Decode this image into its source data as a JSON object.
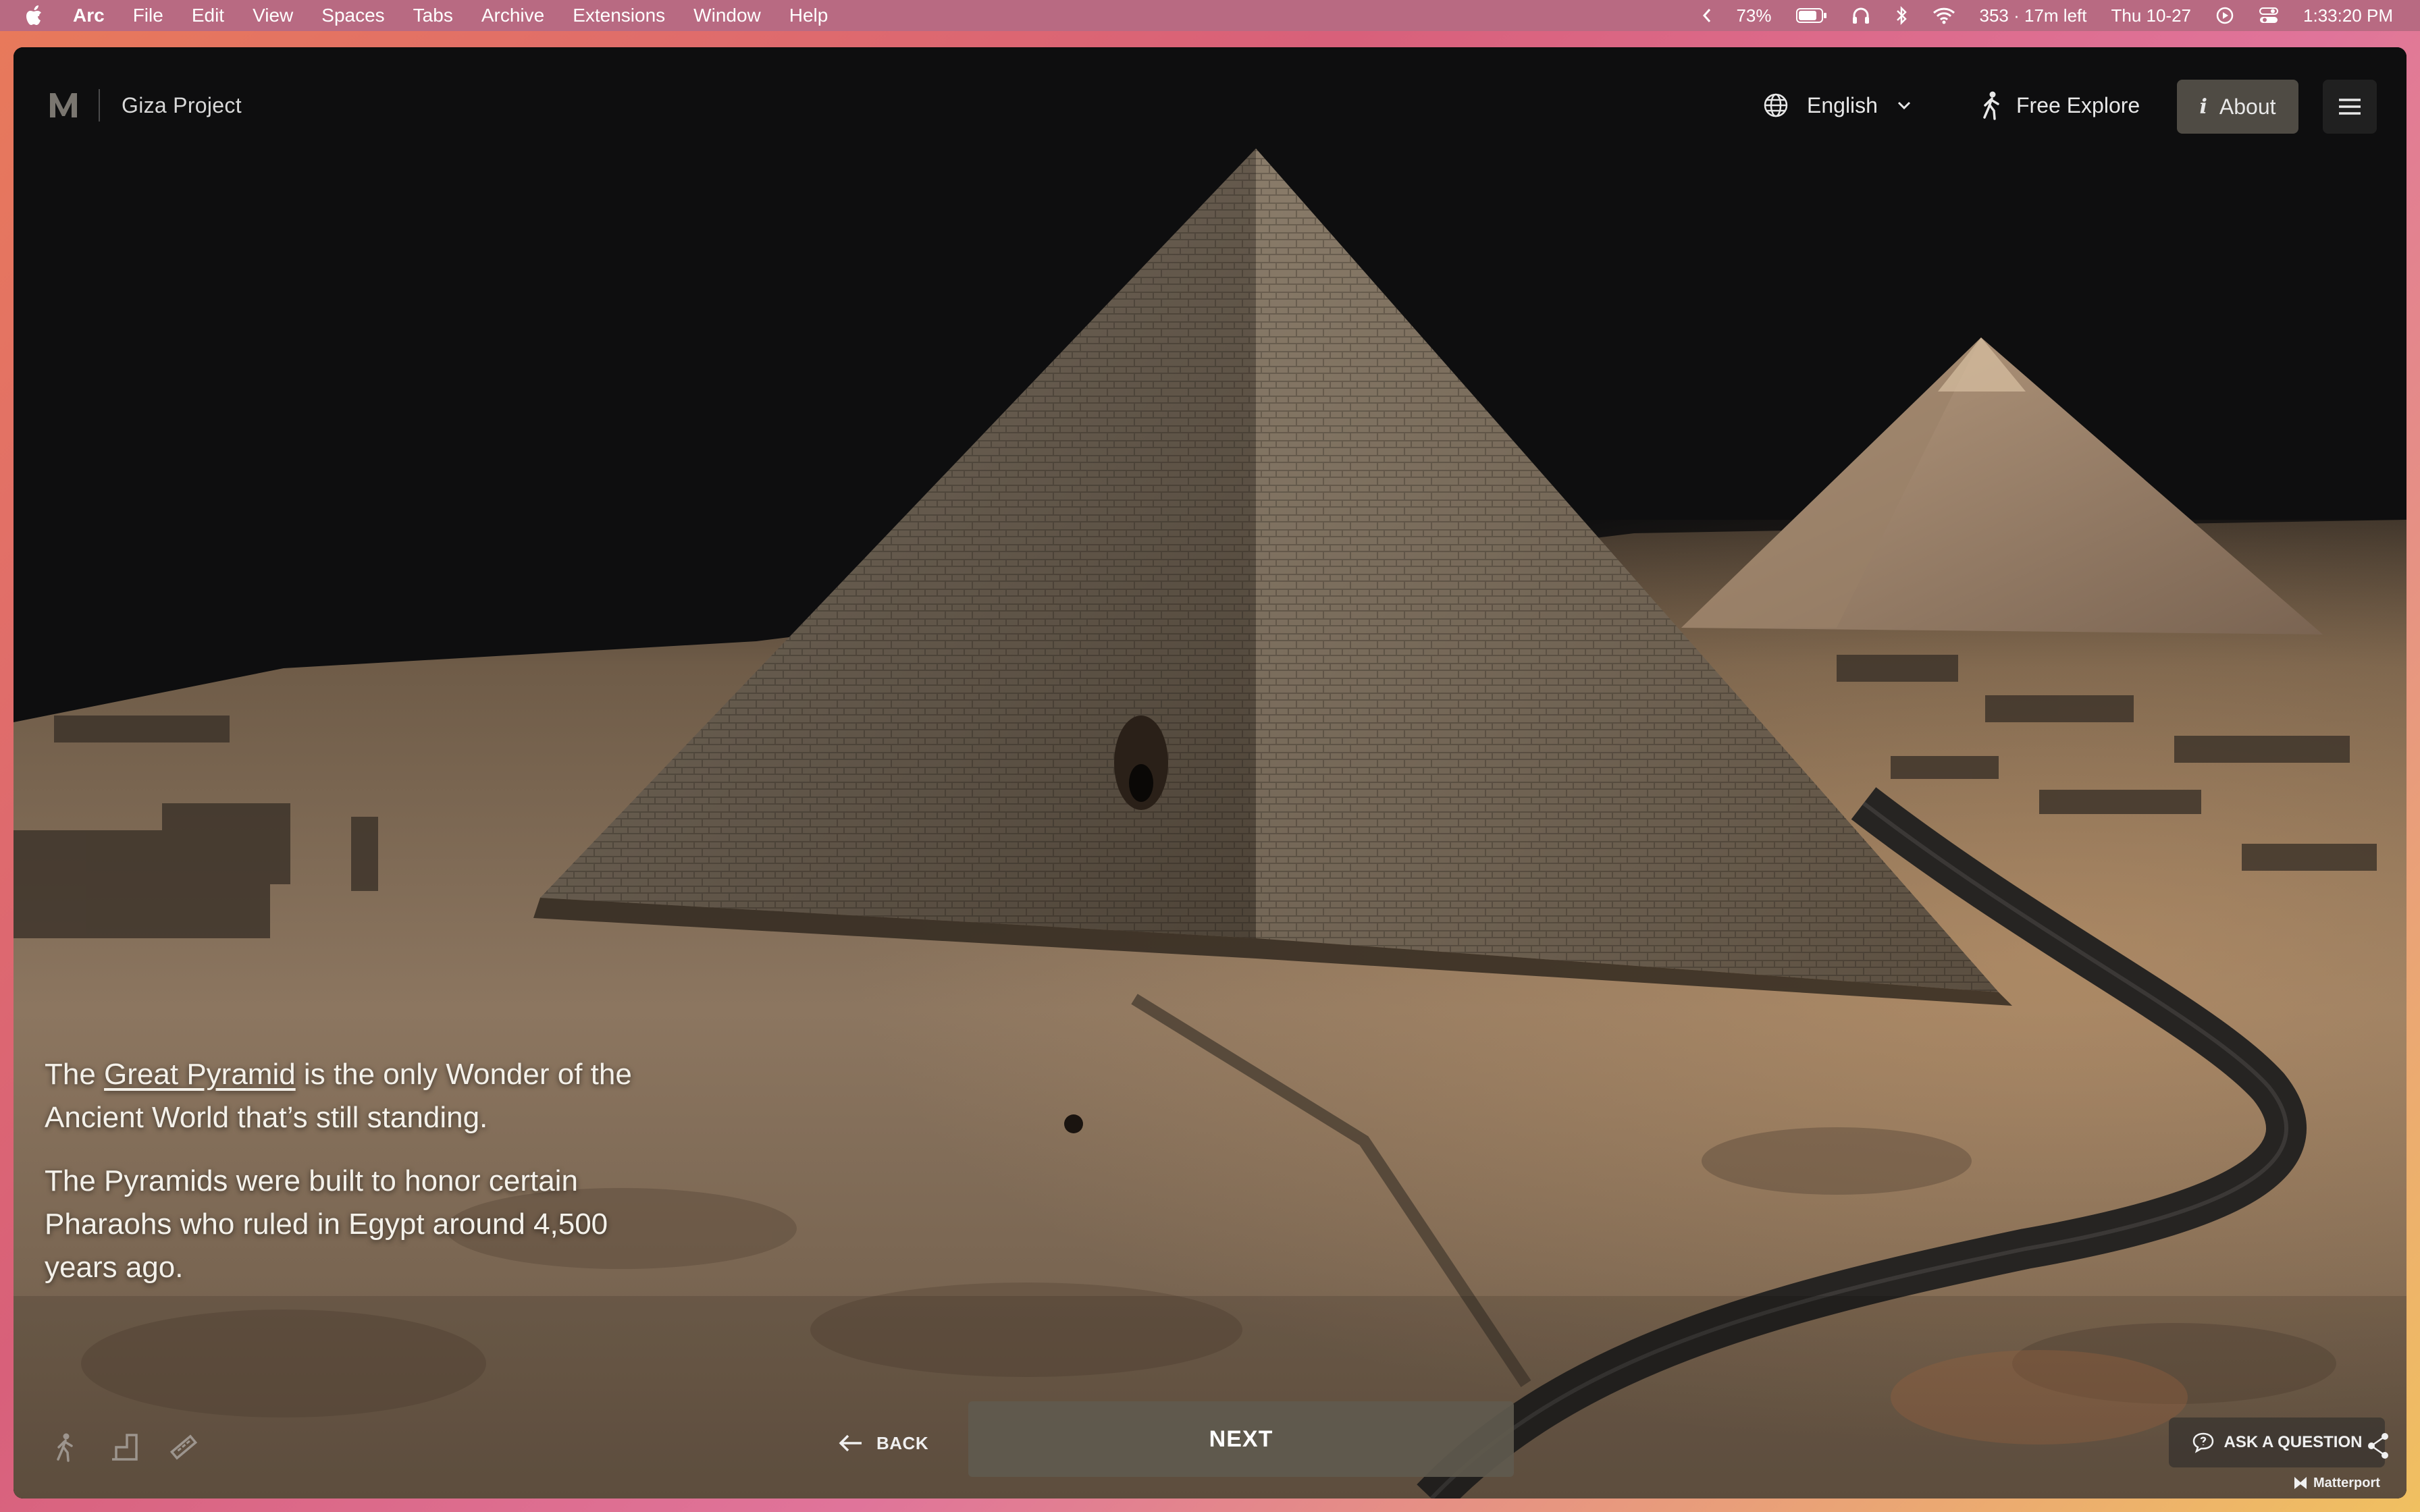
{
  "menubar": {
    "app": "Arc",
    "items": [
      "File",
      "Edit",
      "View",
      "Spaces",
      "Tabs",
      "Archive",
      "Extensions",
      "Window",
      "Help"
    ],
    "battery_percent": "73%",
    "battery_time": "353 · 17m left",
    "date": "Thu 10-27",
    "time": "1:33:20 PM"
  },
  "header": {
    "brand": "Giza Project",
    "language": "English",
    "explore_label": "Free Explore",
    "about_label": "About"
  },
  "story": {
    "p1_before": "The ",
    "p1_link": "Great Pyramid",
    "p1_after": " is the only Wonder of the Ancient World that’s still standing.",
    "p2": "The Pyramids were built to honor certain Pharaohs who ruled in Egypt around 4,500 years ago."
  },
  "controls": {
    "back_label": "BACK",
    "next_label": "NEXT",
    "ask_label": "ASK A QUESTION",
    "matterport_label": "Matterport"
  },
  "colors": {
    "sky": "#0e0e0f",
    "sand": "#8a7258",
    "stone": "#5e5244",
    "road": "#2a2a2a",
    "next_button": "#605a4e"
  }
}
